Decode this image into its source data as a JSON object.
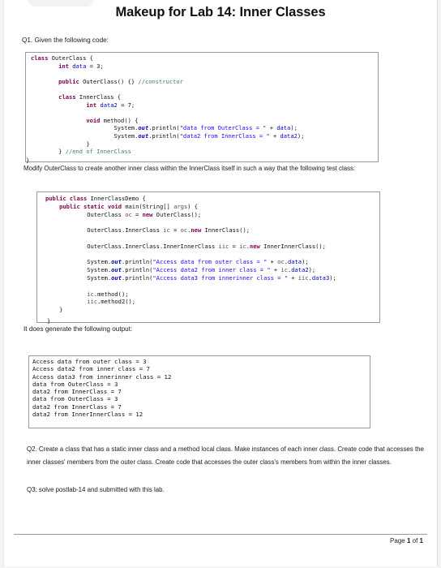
{
  "document": {
    "title": "Makeup for Lab 14: Inner Classes",
    "q1_intro": "Q1. Given the following code:",
    "code1": {
      "lines": [
        "class OuterClass {",
        "    int data = 3;",
        "",
        "    public OuterClass() {} //constructor",
        "",
        "    class InnerClass {",
        "        int data2 = 7;",
        "",
        "        void method() {",
        "            System.out.println(\"data from OuterClass = \" + data);",
        "            System.out.println(\"data2 from InnerClass = \" + data2);",
        "        }",
        "    } //end of InnerClass",
        "}"
      ]
    },
    "q1_instruction": "Modify OuterClass to create another inner class within the InnerClass itself in such a way that the following test class:",
    "code2": {
      "lines": [
        "public class InnerClassDemo {",
        "    public static void main(String[] args) {",
        "        OuterClass oc = new OuterClass();",
        "",
        "        OuterClass.InnerClass ic = oc.new InnerClass();",
        "",
        "        OuterClass.InnerClass.InnerInnerClass iic = ic.new InnerInnerClass();",
        "",
        "        System.out.println(\"Access data from outer class = \" + oc.data);",
        "        System.out.println(\"Access data2 from inner class = \" + ic.data2);",
        "        System.out.println(\"Access data3 from innerinner class = \" + iic.data3);",
        "",
        "        ic.method();",
        "        iic.method2();",
        "    }",
        "}"
      ]
    },
    "output_intro": "It does generate the following output:",
    "output_lines": [
      "Access data from outer class = 3",
      "Access data2 from inner class = 7",
      "Access data3 from innerinner class = 12",
      "data from OuterClass = 3",
      "data2 from InnerClass = 7",
      "data from OuterClass = 3",
      "data2 from InnerClass = 7",
      "data2 from InnerInnerClass = 12"
    ],
    "q2": "Q2. Create a class that has a static inner class and a method local class. Make instances of each inner class. Create code that accesses the inner classes' members from the outer class. Create code that accesses the outer class's members from within the inner classes.",
    "q3": "Q3: solve postlab-14 and submitted with this lab.",
    "footer": {
      "page_label": "Page",
      "page_current": "1",
      "of_label": "of",
      "page_total": "1"
    }
  }
}
